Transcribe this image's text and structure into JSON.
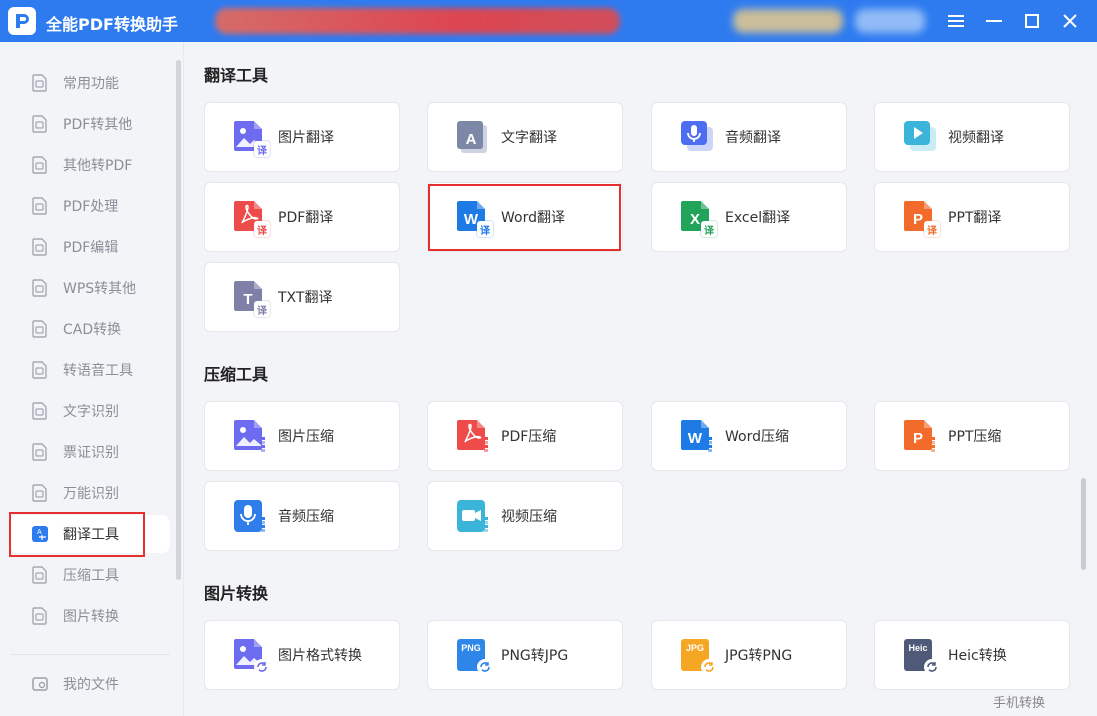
{
  "app": {
    "title": "全能PDF转换助手"
  },
  "sidebar": {
    "items": [
      {
        "label": "常用功能",
        "icon": "home-icon"
      },
      {
        "label": "PDF转其他",
        "icon": "pdf-export-icon"
      },
      {
        "label": "其他转PDF",
        "icon": "pdf-import-icon"
      },
      {
        "label": "PDF处理",
        "icon": "pdf-process-icon"
      },
      {
        "label": "PDF编辑",
        "icon": "pdf-edit-icon"
      },
      {
        "label": "WPS转其他",
        "icon": "wps-icon"
      },
      {
        "label": "CAD转换",
        "icon": "cad-icon"
      },
      {
        "label": "转语音工具",
        "icon": "voice-icon"
      },
      {
        "label": "文字识别",
        "icon": "ocr-icon"
      },
      {
        "label": "票证识别",
        "icon": "ticket-icon"
      },
      {
        "label": "万能识别",
        "icon": "universal-ocr-icon"
      },
      {
        "label": "翻译工具",
        "icon": "translate-icon",
        "active": true
      },
      {
        "label": "压缩工具",
        "icon": "compress-icon"
      },
      {
        "label": "图片转换",
        "icon": "image-convert-icon"
      }
    ],
    "my_files": "我的文件"
  },
  "sections": [
    {
      "title": "翻译工具",
      "cards": [
        {
          "label": "图片翻译",
          "icon": "image-translate-icon"
        },
        {
          "label": "文字翻译",
          "icon": "text-translate-icon"
        },
        {
          "label": "音频翻译",
          "icon": "audio-translate-icon"
        },
        {
          "label": "视频翻译",
          "icon": "video-translate-icon"
        },
        {
          "label": "PDF翻译",
          "icon": "pdf-translate-icon"
        },
        {
          "label": "Word翻译",
          "icon": "word-translate-icon"
        },
        {
          "label": "Excel翻译",
          "icon": "excel-translate-icon"
        },
        {
          "label": "PPT翻译",
          "icon": "ppt-translate-icon"
        },
        {
          "label": "TXT翻译",
          "icon": "txt-translate-icon"
        }
      ]
    },
    {
      "title": "压缩工具",
      "cards": [
        {
          "label": "图片压缩",
          "icon": "image-compress-icon"
        },
        {
          "label": "PDF压缩",
          "icon": "pdf-compress-icon"
        },
        {
          "label": "Word压缩",
          "icon": "word-compress-icon"
        },
        {
          "label": "PPT压缩",
          "icon": "ppt-compress-icon"
        },
        {
          "label": "音频压缩",
          "icon": "audio-compress-icon"
        },
        {
          "label": "视频压缩",
          "icon": "video-compress-icon"
        }
      ]
    },
    {
      "title": "图片转换",
      "cards": [
        {
          "label": "图片格式转换",
          "icon": "image-format-icon"
        },
        {
          "label": "PNG转JPG",
          "icon": "png-to-jpg-icon",
          "tag": "PNG"
        },
        {
          "label": "JPG转PNG",
          "icon": "jpg-to-png-icon",
          "tag": "JPG"
        },
        {
          "label": "Heic转换",
          "icon": "heic-icon",
          "tag": "Heic"
        }
      ]
    }
  ],
  "badges": {
    "translate": "译"
  },
  "footer": {
    "phone_link": "手机转换"
  },
  "colors": {
    "titlebar": "#2e7bf0",
    "highlight": "#e53030",
    "word": "#1e7be6",
    "excel": "#22a35a",
    "ppt": "#f26b2a",
    "pdf": "#ee4b4b",
    "image": "#6d6cf0",
    "video": "#3ab4d8",
    "txt": "#7e80a8"
  }
}
